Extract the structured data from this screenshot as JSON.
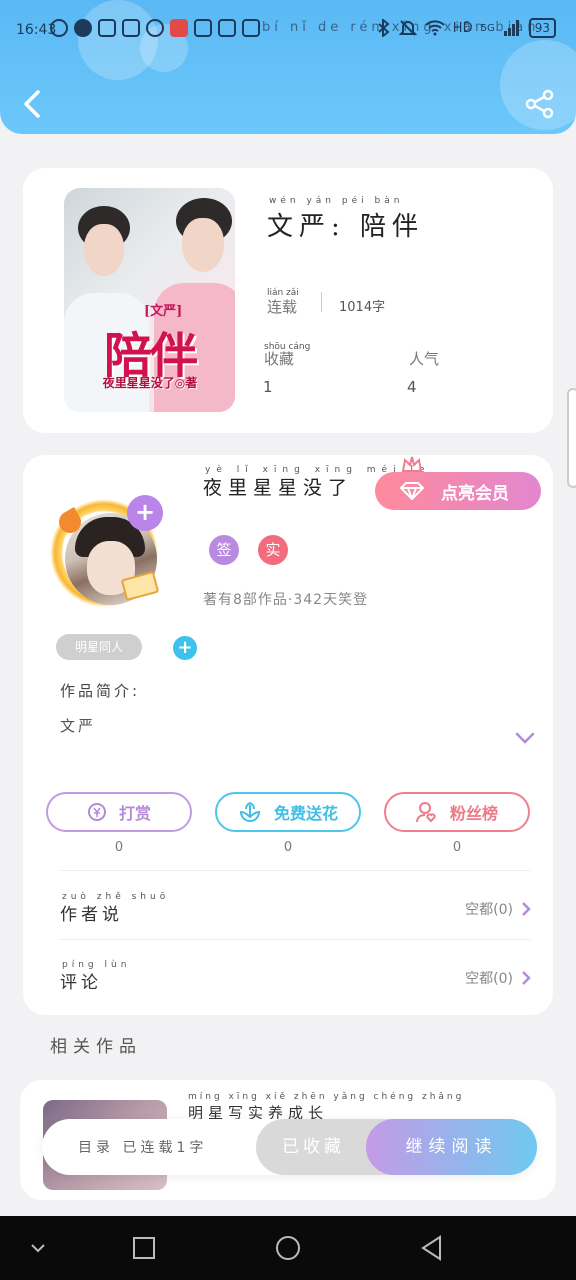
{
  "status_bar": {
    "time": "16:43",
    "ticker": "bí nǐ de rén xǐng xiān biàn",
    "network": "HD",
    "signal": "5G",
    "battery": "93"
  },
  "header": {
    "back_icon": "chevron-left-icon",
    "share_icon": "share-icon"
  },
  "book": {
    "cover_tag": "[文严]",
    "cover_title": "陪伴",
    "cover_author": "夜里星星没了◎著",
    "title": "文严: 陪伴",
    "title_pinyin": "wén yán   péi bàn",
    "status_label": "连载",
    "status_pinyin": "lián zǎi",
    "word_count": "1014字",
    "collect_label": "收藏",
    "collect_pinyin": "shōu cáng",
    "collect_value": "1",
    "popularity_label": "人气",
    "popularity_value": "4"
  },
  "author": {
    "name": "夜里星星没了",
    "name_pinyin": "yè lǐ xīng xīng méi le",
    "vip_button": "点亮会员",
    "badge_sign": "签",
    "badge_real": "实",
    "info": "著有8部作品·342天笑登",
    "tag": "明星同人",
    "tag_add": "+",
    "intro_label": "作品简介:",
    "intro_text": "文严"
  },
  "actions": {
    "tip_label": "打赏",
    "tip_count": "0",
    "flower_label": "免费送花",
    "flower_count": "0",
    "fans_label": "粉丝榜",
    "fans_count": "0"
  },
  "rows": {
    "author_says_label": "作者说",
    "author_says_pinyin": "zuò zhě shuō",
    "author_says_value": "空都(0)",
    "comments_label": "评论",
    "comments_pinyin": "píng lùn",
    "comments_value": "空都(0)"
  },
  "related": {
    "section_title": "相关作品",
    "item_title": "明星写实养成长",
    "item_pinyin": "míng xīng xiě zhēn yǎng chéng zhǎng"
  },
  "bottom_bar": {
    "status": "目录 已连载1字",
    "favorite": "已收藏",
    "continue": "继续阅读"
  },
  "colors": {
    "header": "#5ab8f4",
    "accent_purple": "#b985e8",
    "accent_blue": "#3fbfe6",
    "accent_pink": "#ee7a87"
  }
}
